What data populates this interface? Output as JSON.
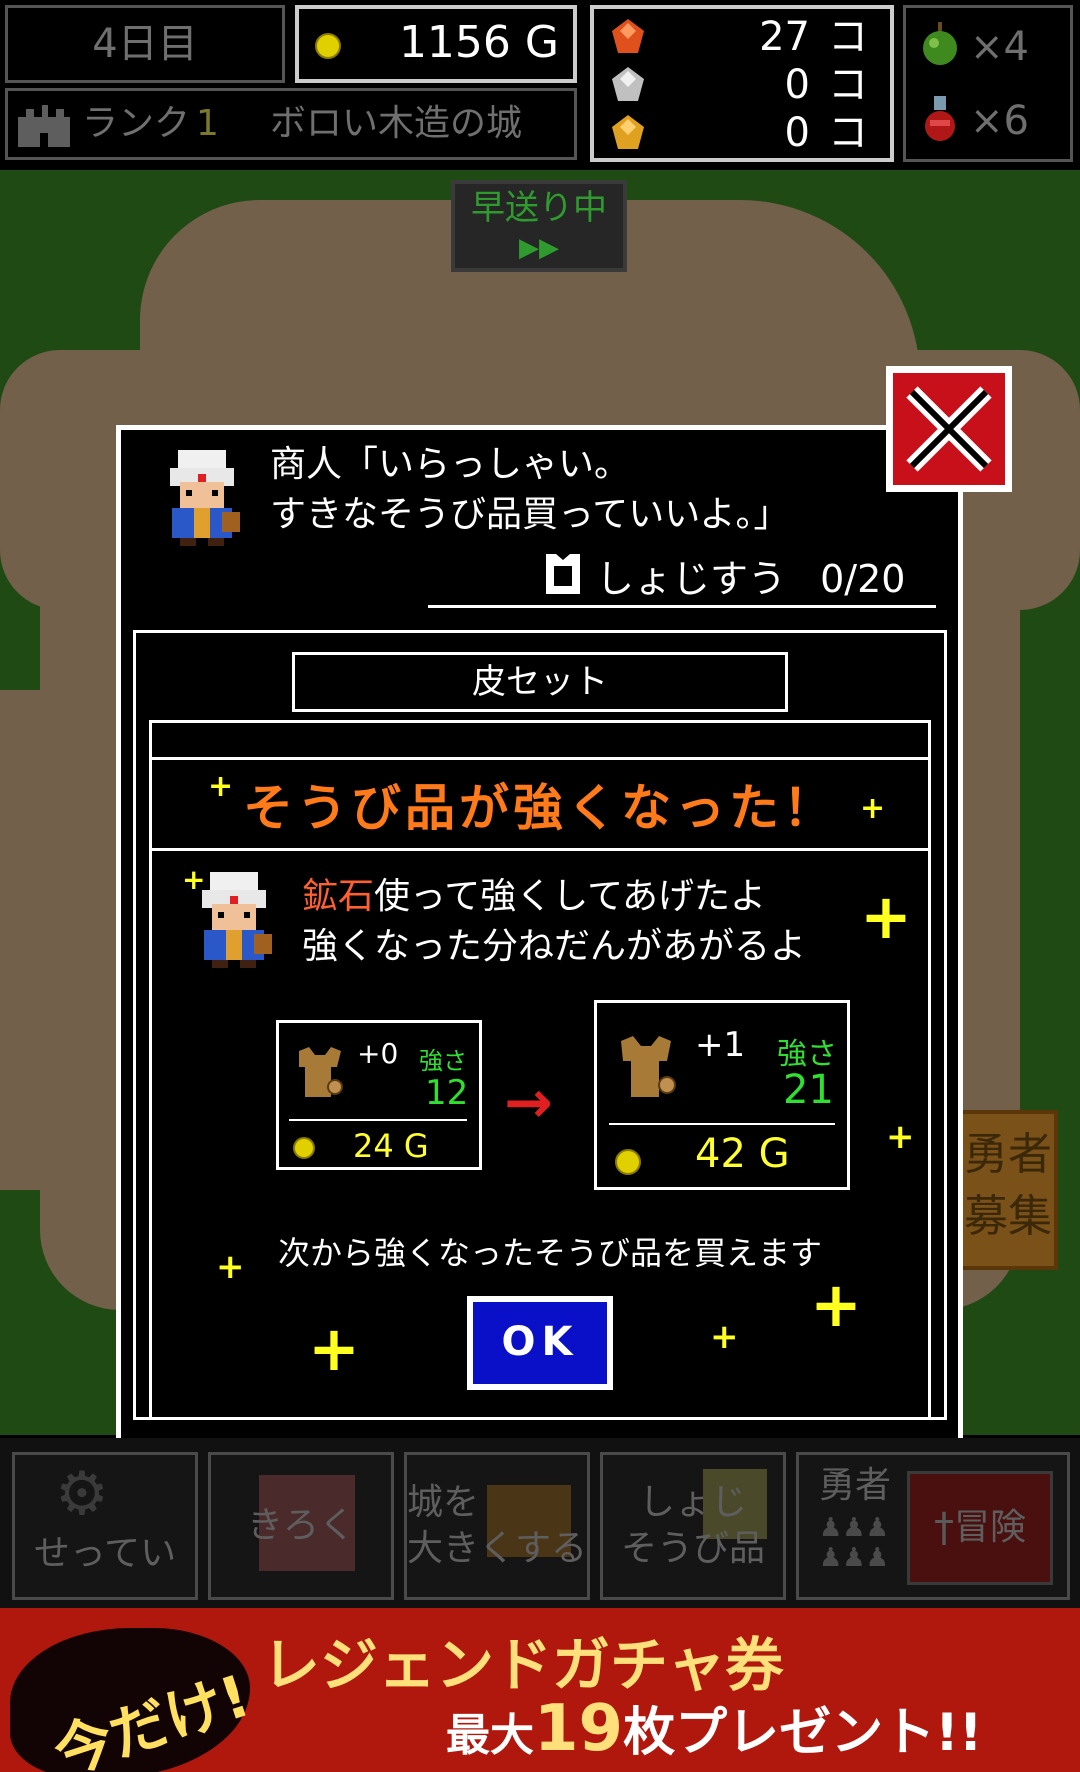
{
  "header": {
    "day": "4日目",
    "gold": "1156 G",
    "rank_label": "ランク",
    "rank_value": "1",
    "castle_name": "ボロい木造の城",
    "ores": [
      {
        "icon": "red-gem-icon",
        "count": "27",
        "unit": "コ",
        "color": "#e0501c"
      },
      {
        "icon": "silver-gem-icon",
        "count": "0",
        "unit": "コ",
        "color": "#c0c0c0"
      },
      {
        "icon": "gold-gem-icon",
        "count": "0",
        "unit": "コ",
        "color": "#e0a020"
      }
    ],
    "items": [
      {
        "icon": "apple-icon",
        "count": "×4"
      },
      {
        "icon": "potion-icon",
        "count": "×6"
      }
    ]
  },
  "map": {
    "fast_forward_label": "早送り中",
    "fast_forward_arrows": "▶▶",
    "recruit_sign": "勇者募集"
  },
  "dialog": {
    "merchant_line1": "商人「いらっしゃい。",
    "merchant_line2": "すきなそうび品買っていいよ。」",
    "inventory_label": "しょじすう",
    "inventory_value": "0/20",
    "set_name": "皮セット",
    "banner": "そうび品が強くなった！",
    "msg_ore": "鉱石",
    "msg_line1_rest": "使って強くしてあげたよ",
    "msg_line2": "強くなった分ねだんがあがるよ",
    "before": {
      "plus": "+0",
      "strength_label": "強さ",
      "strength": "12",
      "price": "24 G"
    },
    "after": {
      "plus": "+1",
      "strength_label": "強さ",
      "strength": "21",
      "price": "42 G"
    },
    "arrow": "→",
    "footer": "次から強くなったそうび品を買えます",
    "ok_label": "OK",
    "close_icon": "close-x-icon"
  },
  "menu": {
    "b1": "せってい",
    "b2": "きろく",
    "b3_line1": "城を",
    "b3_line2": "大きくする",
    "b4_line1": "しょじ",
    "b4_line2": "そうび品",
    "b5_label": "勇者",
    "b5_action": "冒険"
  },
  "ad": {
    "tag": "今だけ!",
    "line1": "レジェンドガチャ券",
    "line2_a": "最大",
    "line2_num": "19",
    "line2_b": "枚プレゼント!!"
  },
  "colors": {
    "accent_orange": "#ff7a18",
    "gold_yellow": "#ffff30",
    "strength_green": "#30e030",
    "ok_blue": "#0a10c8",
    "close_red": "#c8101a",
    "ad_red": "#b0180e"
  }
}
